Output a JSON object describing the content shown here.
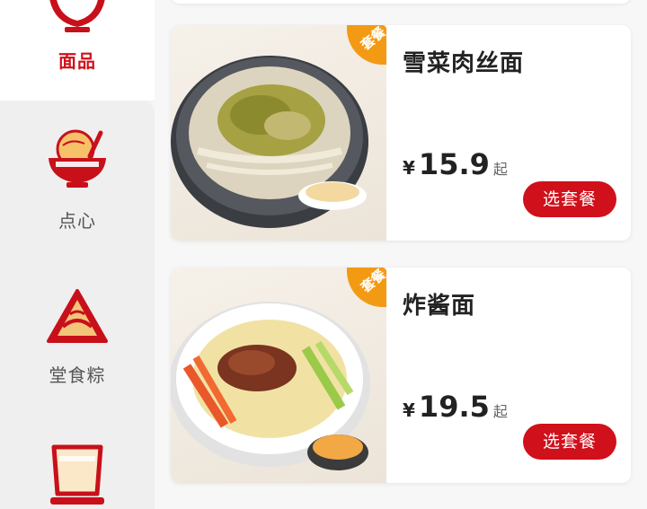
{
  "sidebar": {
    "items": [
      {
        "label": "面品",
        "active": true,
        "icon": "noodle-bowl-icon"
      },
      {
        "label": "点心",
        "active": false,
        "icon": "dim-sum-bowl-icon"
      },
      {
        "label": "堂食粽",
        "active": false,
        "icon": "zongzi-icon"
      },
      {
        "label": "",
        "active": false,
        "icon": "drink-cup-icon"
      }
    ]
  },
  "products": [
    {
      "name": "雪菜肉丝面",
      "badge": "套餐",
      "currency": "¥",
      "price": "15.9",
      "unit": "起",
      "button": "选套餐"
    },
    {
      "name": "炸酱面",
      "badge": "套餐",
      "currency": "¥",
      "price": "19.5",
      "unit": "起",
      "button": "选套餐"
    }
  ],
  "colors": {
    "accent": "#d0101b",
    "badge": "#f39a15"
  }
}
